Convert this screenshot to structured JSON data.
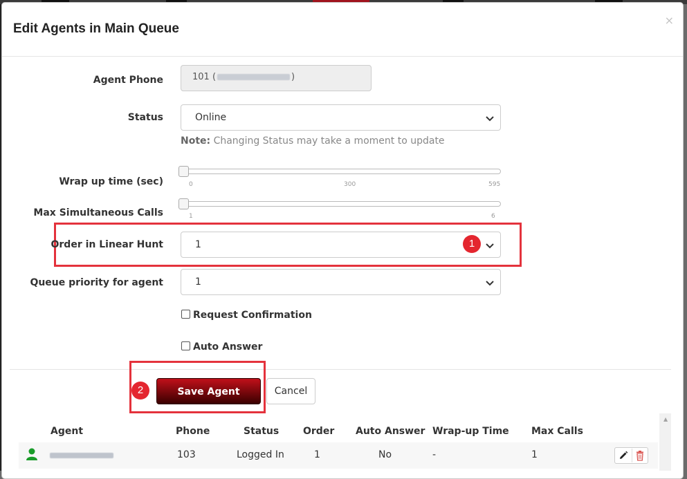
{
  "modal": {
    "title": "Edit Agents in Main Queue",
    "close": "×"
  },
  "form": {
    "agent_phone": {
      "label": "Agent Phone",
      "value_prefix": "101 (",
      "value_suffix": ")"
    },
    "status": {
      "label": "Status",
      "selected": "Online"
    },
    "note": {
      "bold": "Note:",
      "text": " Changing Status may take a moment to update"
    },
    "wrap_up": {
      "label": "Wrap up time (sec)",
      "value": 0,
      "ticks": [
        "0",
        "300",
        "595"
      ]
    },
    "max_calls": {
      "label": "Max Simultaneous Calls",
      "value": 1,
      "ticks": [
        "1",
        "6"
      ]
    },
    "order": {
      "label": "Order in Linear Hunt",
      "selected": "1"
    },
    "priority": {
      "label": "Queue priority for agent",
      "selected": "1"
    },
    "request_confirmation": {
      "label": "Request Confirmation",
      "checked": false
    },
    "auto_answer": {
      "label": "Auto Answer",
      "checked": false
    }
  },
  "annotations": {
    "badge1": "1",
    "badge2": "2",
    "highlight_color": "#e4323c"
  },
  "buttons": {
    "save": "Save Agent",
    "cancel": "Cancel"
  },
  "table": {
    "headers": [
      "Agent",
      "Phone",
      "Status",
      "Order",
      "Auto Answer",
      "Wrap-up Time",
      "Max Calls"
    ],
    "rows": [
      {
        "agent": "",
        "phone": "103",
        "status": "Logged In",
        "order": "1",
        "auto_answer": "No",
        "wrap_up": "-",
        "max_calls": "1"
      }
    ]
  },
  "icons": {
    "user": "user-icon",
    "edit": "pencil-icon",
    "delete": "trash-icon",
    "chevron": "chevron-down-icon",
    "close": "close-icon"
  },
  "colors": {
    "accent_red": "#c0101a",
    "user_green": "#1a9c2a",
    "delete_red": "#d9534f"
  }
}
